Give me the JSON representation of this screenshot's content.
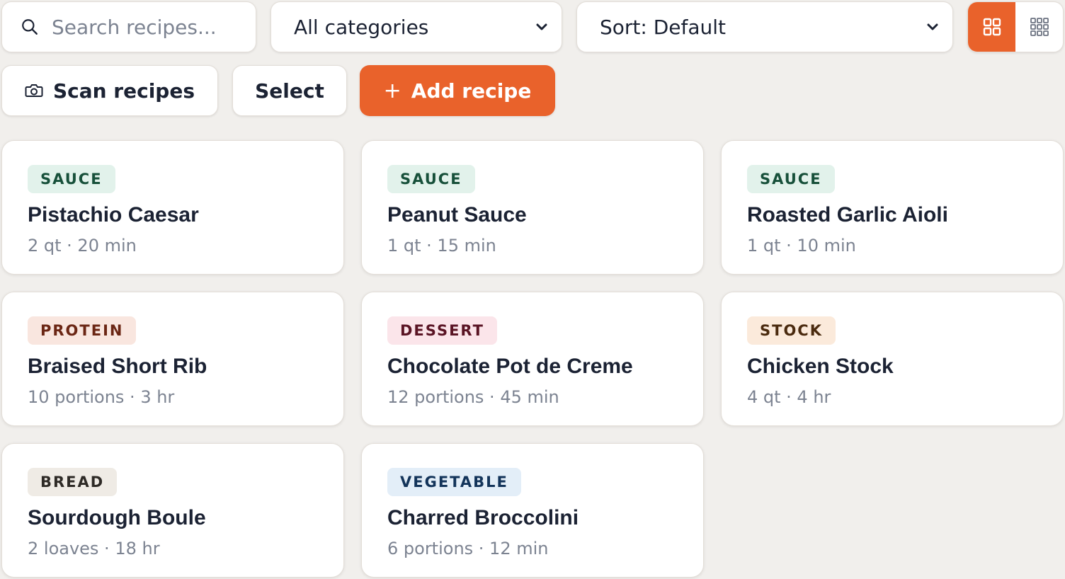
{
  "toolbar": {
    "search_placeholder": "Search recipes...",
    "category_value": "All categories",
    "sort_value": "Sort: Default",
    "view_modes": [
      "grid-large",
      "grid-small"
    ],
    "active_view": "grid-large"
  },
  "actions": {
    "scan_label": "Scan recipes",
    "select_label": "Select",
    "add_label": "Add recipe",
    "add_icon": "+"
  },
  "colors": {
    "accent": "#e9622b",
    "background": "#f1efec",
    "sauce_badge_bg": "#e2f2eb",
    "sauce_badge_fg": "#17503a",
    "protein_badge_bg": "#f9e6df",
    "protein_badge_fg": "#6b2614",
    "dessert_badge_bg": "#fbe5ea",
    "dessert_badge_fg": "#5a1424",
    "stock_badge_bg": "#fbeadb",
    "stock_badge_fg": "#4a2a0e",
    "bread_badge_bg": "#efebe5",
    "bread_badge_fg": "#2e2a26",
    "vegetable_badge_bg": "#e3eef8",
    "vegetable_badge_fg": "#13345a"
  },
  "recipes": [
    {
      "category": "SAUCE",
      "title": "Pistachio Caesar",
      "meta": "2 qt · 20 min"
    },
    {
      "category": "SAUCE",
      "title": "Peanut Sauce",
      "meta": "1 qt · 15 min"
    },
    {
      "category": "SAUCE",
      "title": "Roasted Garlic Aioli",
      "meta": "1 qt · 10 min"
    },
    {
      "category": "PROTEIN",
      "title": "Braised Short Rib",
      "meta": "10 portions · 3 hr"
    },
    {
      "category": "DESSERT",
      "title": "Chocolate Pot de Creme",
      "meta": "12 portions · 45 min"
    },
    {
      "category": "STOCK",
      "title": "Chicken Stock",
      "meta": "4 qt · 4 hr"
    },
    {
      "category": "BREAD",
      "title": "Sourdough Boule",
      "meta": "2 loaves · 18 hr"
    },
    {
      "category": "VEGETABLE",
      "title": "Charred Broccolini",
      "meta": "6 portions · 12 min"
    }
  ]
}
